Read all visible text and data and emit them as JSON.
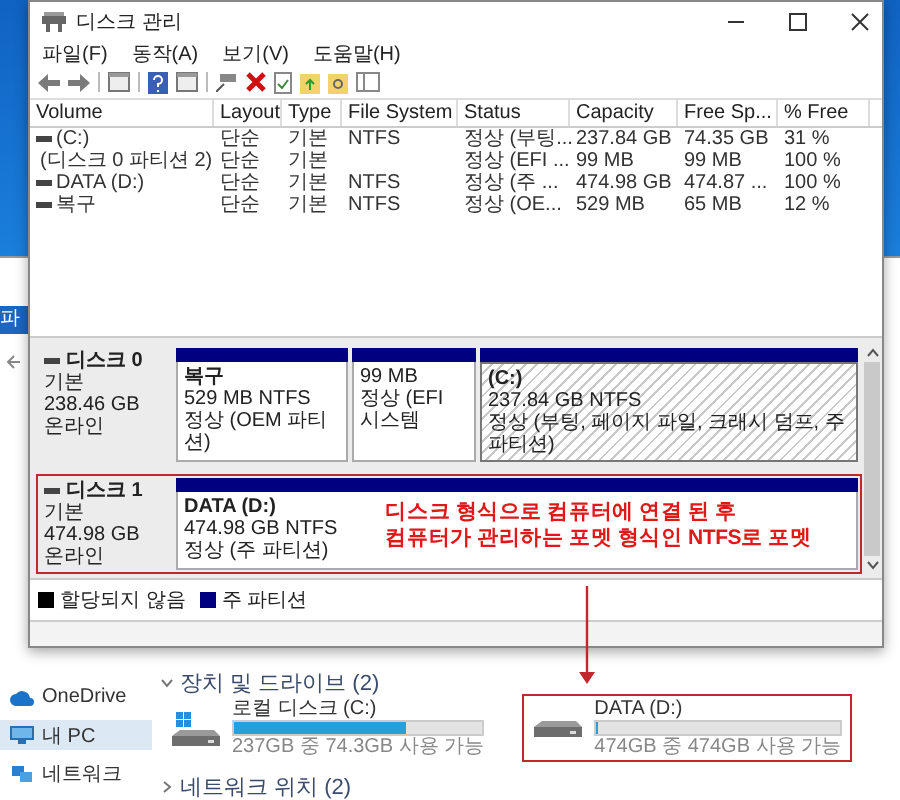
{
  "window": {
    "title": "디스크 관리"
  },
  "menu": [
    "파일(F)",
    "동작(A)",
    "보기(V)",
    "도움말(H)"
  ],
  "table": {
    "columns": [
      "Volume",
      "Layout",
      "Type",
      "File System",
      "Status",
      "Capacity",
      "Free Sp...",
      "% Free"
    ],
    "rows": [
      [
        "(C:)",
        "단순",
        "기본",
        "NTFS",
        "정상 (부팅...",
        "237.84 GB",
        "74.35 GB",
        "31 %"
      ],
      [
        "(디스크 0 파티션 2)",
        "단순",
        "기본",
        null,
        "정상 (EFI ...",
        "99 MB",
        "99 MB",
        "100 %"
      ],
      [
        "DATA (D:)",
        "단순",
        "기본",
        "NTFS",
        "정상 (주 ...",
        "474.98 GB",
        "474.87 ...",
        "100 %"
      ],
      [
        "복구",
        "단순",
        "기본",
        "NTFS",
        "정상 (OE...",
        "529 MB",
        "65 MB",
        "12 %"
      ]
    ]
  },
  "disks": [
    {
      "name": "디스크 0",
      "type": "기본",
      "size": "238.46 GB",
      "status": "온라인",
      "highlighted": false,
      "partitions": [
        {
          "title": "복구",
          "size": "529 MB NTFS",
          "status": "정상 (OEM 파티션)",
          "selected": false
        },
        {
          "size": "99 MB",
          "status": "정상 (EFI 시스템",
          "selected": false
        },
        {
          "title": "(C:)",
          "size": "237.84 GB NTFS",
          "status": "정상 (부팅, 페이지 파일, 크래시 덤프, 주 파티션)",
          "selected": true
        }
      ]
    },
    {
      "name": "디스크 1",
      "type": "기본",
      "size": "474.98 GB",
      "status": "온라인",
      "highlighted": true,
      "partitions": [
        {
          "title": "DATA  (D:)",
          "size": "474.98 GB NTFS",
          "status": "정상 (주 파티션)",
          "selected": false
        }
      ]
    }
  ],
  "annotation": [
    "디스크 형식으로 컴퓨터에 연결 된 후",
    "컴퓨터가 관리하는 포멧 형식인 NTFS로 포멧"
  ],
  "legend": [
    {
      "label": "할당되지 않음",
      "color": "#000000"
    },
    {
      "label": "주 파티션",
      "color": "#000080"
    }
  ],
  "explorer": {
    "ribbon_tab": "파",
    "nav": [
      {
        "label": "OneDrive",
        "selected": false
      },
      {
        "label": "내 PC",
        "selected": true
      },
      {
        "label": "네트워크",
        "selected": false
      }
    ],
    "sections": [
      {
        "title": "장치 및 드라이브 (2)",
        "expanded": true
      },
      {
        "title": "네트워크 위치 (2)",
        "expanded": false
      }
    ],
    "drives": [
      {
        "name": "로컬 디스크 (C:)",
        "level": 0.69,
        "free": "237GB 중 74.3GB 사용 가능",
        "system": true,
        "highlighted": false
      },
      {
        "name": "DATA (D:)",
        "level": 0,
        "free": "474GB 중 474GB 사용 가능",
        "system": false,
        "highlighted": true
      }
    ]
  }
}
